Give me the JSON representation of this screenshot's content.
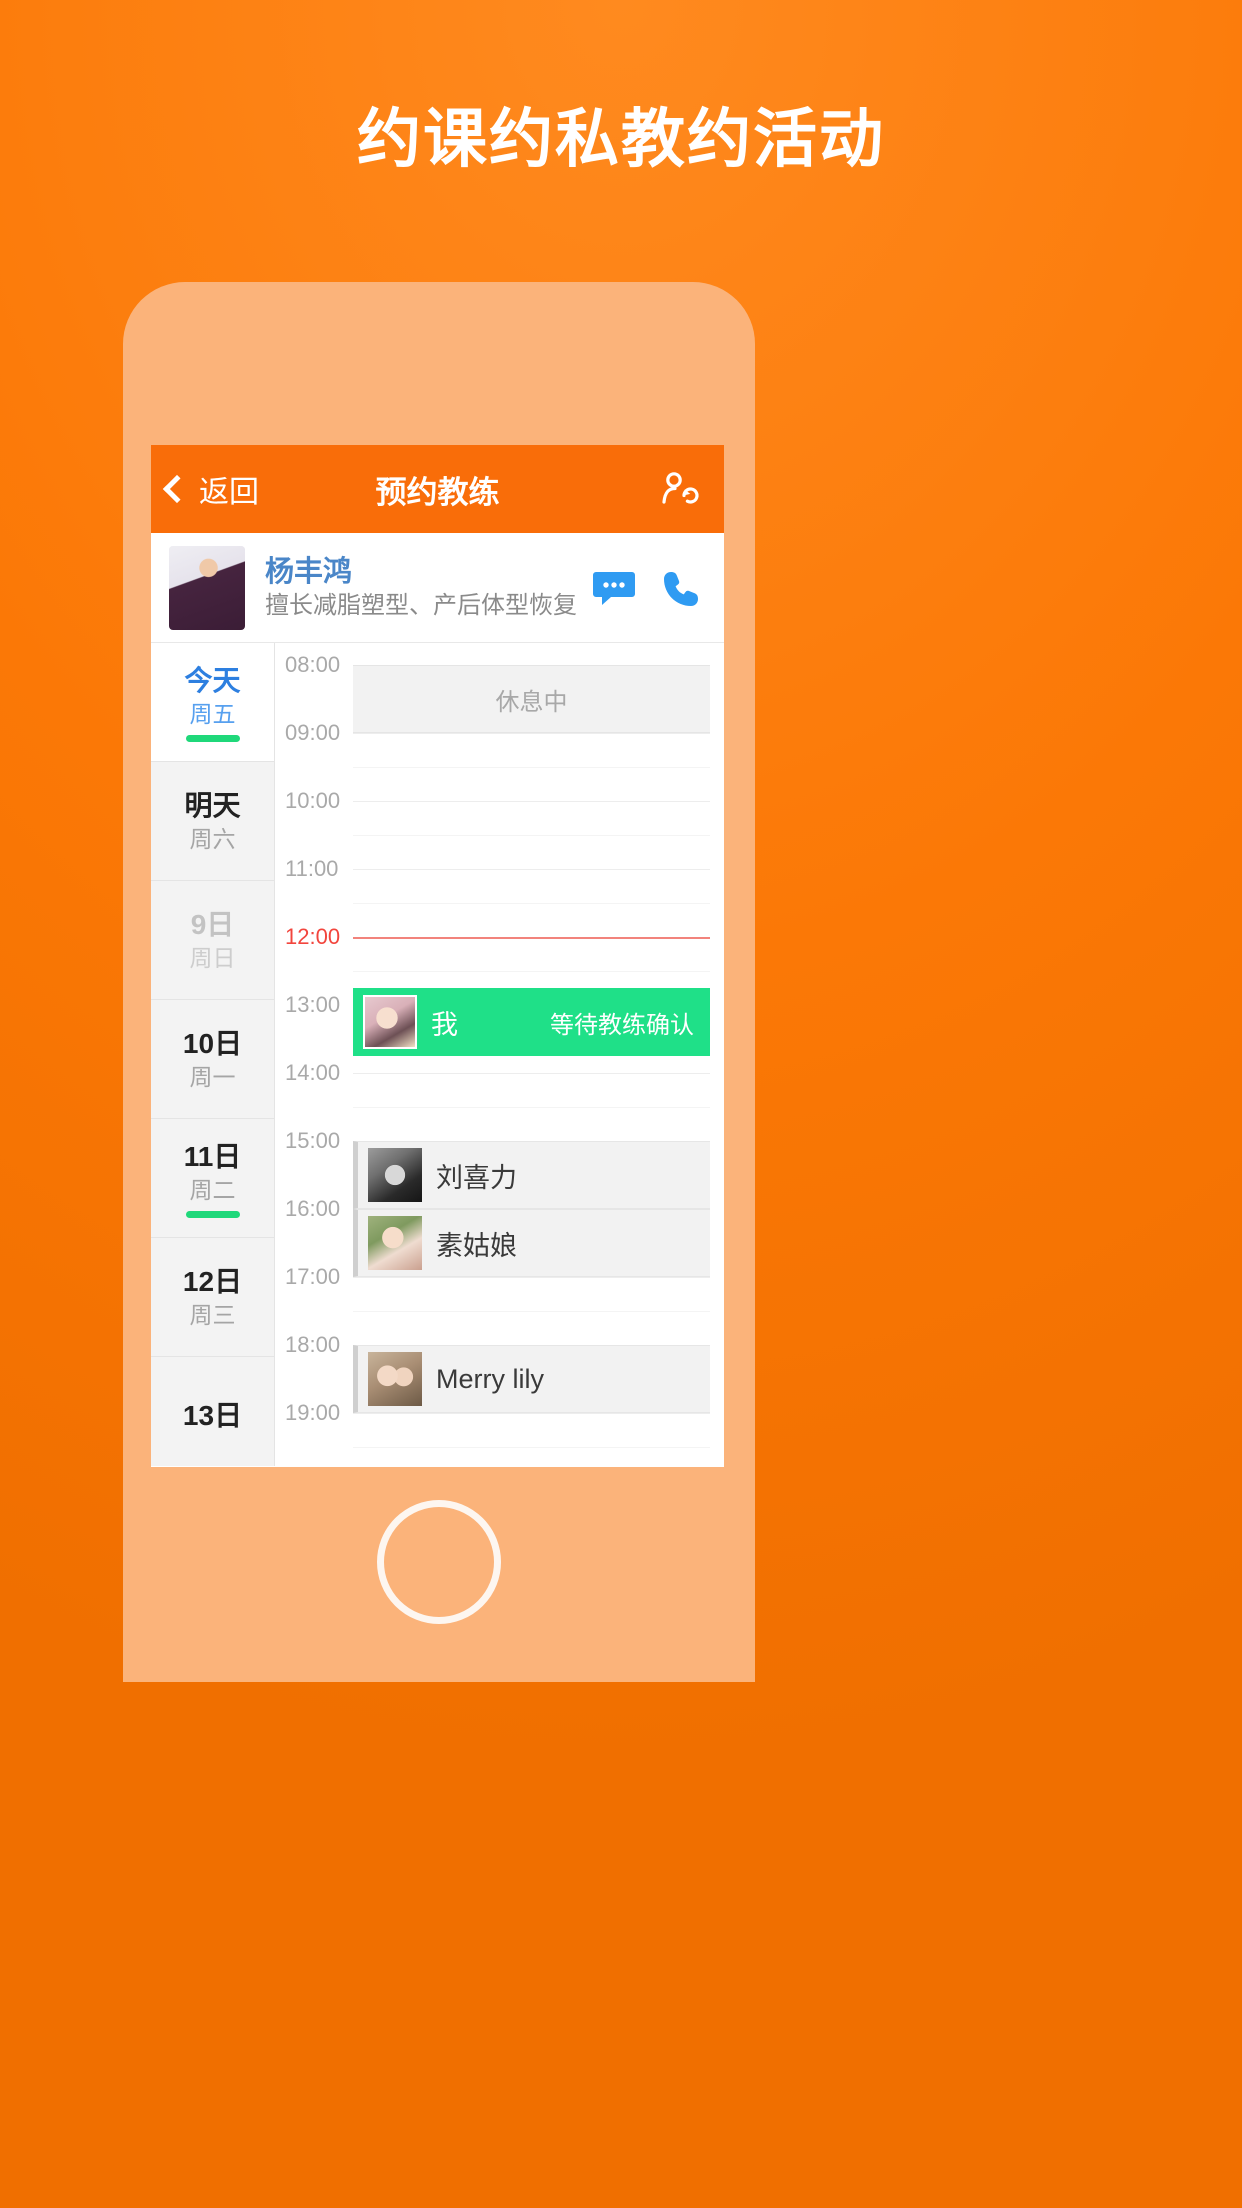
{
  "promo": {
    "headline": "约课约私教约活动"
  },
  "colors": {
    "background_orange": "#fb7806",
    "navbar_orange": "#f96d09",
    "accent_green": "#1fe088",
    "underline_green": "#1fd87a",
    "selected_blue": "#2d7fe0",
    "now_red": "#f2453d",
    "phone_body": "#fbb37a"
  },
  "navbar": {
    "back_label": "返回",
    "title": "预约教练",
    "back_icon": "chevron-left-icon",
    "right_icon": "switch-coach-icon"
  },
  "coach": {
    "name": "杨丰鸿",
    "description": "擅长减脂塑型、产后体型恢复...",
    "avatar_alt": "coach-avatar",
    "message_icon": "message-bubble-icon",
    "call_icon": "phone-icon"
  },
  "days": [
    {
      "title": "今天",
      "weekday": "周五",
      "selected": true,
      "dimmed": false,
      "underline": true
    },
    {
      "title": "明天",
      "weekday": "周六",
      "selected": false,
      "dimmed": false,
      "underline": false
    },
    {
      "title": "9日",
      "weekday": "周日",
      "selected": false,
      "dimmed": true,
      "underline": false
    },
    {
      "title": "10日",
      "weekday": "周一",
      "selected": false,
      "dimmed": false,
      "underline": false
    },
    {
      "title": "11日",
      "weekday": "周二",
      "selected": false,
      "dimmed": false,
      "underline": true
    },
    {
      "title": "12日",
      "weekday": "周三",
      "selected": false,
      "dimmed": false,
      "underline": false
    },
    {
      "title": "13日",
      "weekday": "",
      "selected": false,
      "dimmed": false,
      "underline": false
    }
  ],
  "timeline": {
    "hours": [
      "08:00",
      "09:00",
      "10:00",
      "11:00",
      "12:00",
      "13:00",
      "14:00",
      "15:00",
      "16:00",
      "17:00",
      "18:00",
      "19:00"
    ],
    "current_time": "12:00"
  },
  "events": [
    {
      "type": "rest",
      "label": "休息中",
      "start": "08:00",
      "end": "09:00"
    },
    {
      "type": "mine",
      "name": "我",
      "status": "等待教练确认",
      "avatar": "my-avatar",
      "start": "12:45",
      "end": "13:45"
    },
    {
      "type": "booked",
      "name": "刘喜力",
      "avatar": "liu-avatar",
      "start": "15:00",
      "end": "16:00"
    },
    {
      "type": "booked",
      "name": "素姑娘",
      "avatar": "su-avatar",
      "start": "16:00",
      "end": "17:00"
    },
    {
      "type": "booked",
      "name": "Merry lily",
      "avatar": "merry-avatar",
      "start": "18:00",
      "end": "19:00"
    }
  ]
}
